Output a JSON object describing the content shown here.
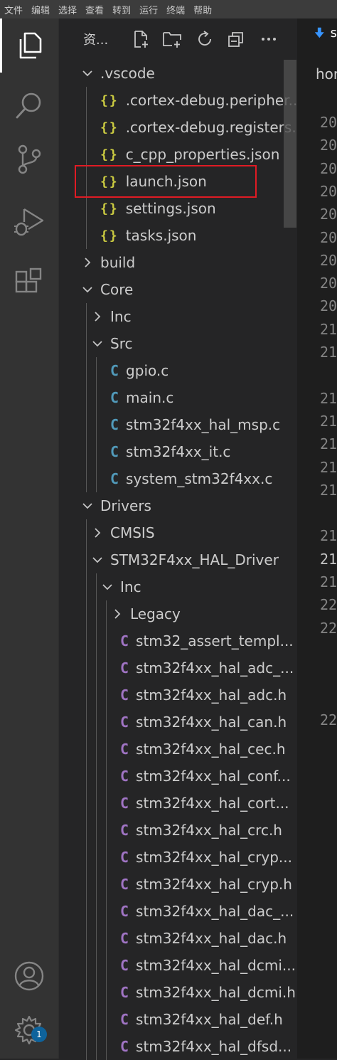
{
  "menu": [
    "文件",
    "编辑",
    "选择",
    "查看",
    "转到",
    "运行",
    "终端",
    "帮助"
  ],
  "activity_bar": {
    "items": [
      {
        "name": "explorer-icon",
        "active": true
      },
      {
        "name": "search-icon"
      },
      {
        "name": "source-control-icon"
      },
      {
        "name": "run-debug-icon"
      },
      {
        "name": "extensions-icon"
      }
    ],
    "bottom": [
      {
        "name": "account-icon"
      },
      {
        "name": "manage-gear-icon",
        "badge": "1"
      }
    ]
  },
  "sidebar": {
    "title": "资...",
    "actions": [
      "new-file-icon",
      "new-folder-icon",
      "refresh-icon",
      "collapse-all-icon",
      "more-icon"
    ],
    "tree": [
      {
        "label": ".vscode",
        "depth": 0,
        "type": "folder",
        "open": true
      },
      {
        "label": ".cortex-debug.peripher...",
        "depth": 1,
        "type": "json"
      },
      {
        "label": ".cortex-debug.registers...",
        "depth": 1,
        "type": "json"
      },
      {
        "label": "c_cpp_properties.json",
        "depth": 1,
        "type": "json"
      },
      {
        "label": "launch.json",
        "depth": 1,
        "type": "json",
        "highlighted": true
      },
      {
        "label": "settings.json",
        "depth": 1,
        "type": "json"
      },
      {
        "label": "tasks.json",
        "depth": 1,
        "type": "json"
      },
      {
        "label": "build",
        "depth": 0,
        "type": "folder",
        "open": false
      },
      {
        "label": "Core",
        "depth": 0,
        "type": "folder",
        "open": true
      },
      {
        "label": "Inc",
        "depth": 1,
        "type": "folder",
        "open": false
      },
      {
        "label": "Src",
        "depth": 1,
        "type": "folder",
        "open": true
      },
      {
        "label": "gpio.c",
        "depth": 2,
        "type": "c"
      },
      {
        "label": "main.c",
        "depth": 2,
        "type": "c"
      },
      {
        "label": "stm32f4xx_hal_msp.c",
        "depth": 2,
        "type": "c"
      },
      {
        "label": "stm32f4xx_it.c",
        "depth": 2,
        "type": "c"
      },
      {
        "label": "system_stm32f4xx.c",
        "depth": 2,
        "type": "c"
      },
      {
        "label": "Drivers",
        "depth": 0,
        "type": "folder",
        "open": true
      },
      {
        "label": "CMSIS",
        "depth": 1,
        "type": "folder",
        "open": false
      },
      {
        "label": "STM32F4xx_HAL_Driver",
        "depth": 1,
        "type": "folder",
        "open": true
      },
      {
        "label": "Inc",
        "depth": 2,
        "type": "folder",
        "open": true
      },
      {
        "label": "Legacy",
        "depth": 3,
        "type": "folder",
        "open": false
      },
      {
        "label": "stm32_assert_templ...",
        "depth": 3,
        "type": "h"
      },
      {
        "label": "stm32f4xx_hal_adc_...",
        "depth": 3,
        "type": "h"
      },
      {
        "label": "stm32f4xx_hal_adc.h",
        "depth": 3,
        "type": "h"
      },
      {
        "label": "stm32f4xx_hal_can.h",
        "depth": 3,
        "type": "h"
      },
      {
        "label": "stm32f4xx_hal_cec.h",
        "depth": 3,
        "type": "h"
      },
      {
        "label": "stm32f4xx_hal_conf...",
        "depth": 3,
        "type": "h"
      },
      {
        "label": "stm32f4xx_hal_cort...",
        "depth": 3,
        "type": "h"
      },
      {
        "label": "stm32f4xx_hal_crc.h",
        "depth": 3,
        "type": "h"
      },
      {
        "label": "stm32f4xx_hal_cryp...",
        "depth": 3,
        "type": "h"
      },
      {
        "label": "stm32f4xx_hal_cryp.h",
        "depth": 3,
        "type": "h"
      },
      {
        "label": "stm32f4xx_hal_dac_...",
        "depth": 3,
        "type": "h"
      },
      {
        "label": "stm32f4xx_hal_dac.h",
        "depth": 3,
        "type": "h"
      },
      {
        "label": "stm32f4xx_hal_dcmi...",
        "depth": 3,
        "type": "h"
      },
      {
        "label": "stm32f4xx_hal_dcmi.h",
        "depth": 3,
        "type": "h"
      },
      {
        "label": "stm32f4xx_hal_def.h",
        "depth": 3,
        "type": "h"
      },
      {
        "label": "stm32f4xx_hal_dfsd...",
        "depth": 3,
        "type": "h"
      }
    ]
  },
  "editor": {
    "tab_label": "s",
    "breadcrumb": "hor",
    "line_numbers": [
      {
        "text": "20",
        "line": 1
      },
      {
        "text": "20",
        "line": 2
      },
      {
        "text": "20",
        "line": 3
      },
      {
        "text": "20",
        "line": 4
      },
      {
        "text": "20",
        "line": 5
      },
      {
        "text": "20",
        "line": 6
      },
      {
        "text": "20",
        "line": 7
      },
      {
        "text": "20",
        "line": 8
      },
      {
        "text": "20",
        "line": 9
      },
      {
        "text": "21",
        "line": 10
      },
      {
        "text": "21",
        "line": 11
      },
      {
        "text": "21",
        "line": 13
      },
      {
        "text": "21",
        "line": 14
      },
      {
        "text": "21",
        "line": 15
      },
      {
        "text": "21",
        "line": 16
      },
      {
        "text": "21",
        "line": 17
      },
      {
        "text": "21",
        "line": 19
      },
      {
        "text": "21",
        "line": 20,
        "current": true
      },
      {
        "text": "21",
        "line": 21
      },
      {
        "text": "22",
        "line": 22
      },
      {
        "text": "22",
        "line": 23
      },
      {
        "text": "22",
        "line": 27
      }
    ]
  },
  "colors": {
    "json_icon": "#cbcb41",
    "c_icon": "#519aba",
    "h_icon": "#a074c4",
    "highlight_box": "#e01b24",
    "badge": "#0e639c"
  }
}
